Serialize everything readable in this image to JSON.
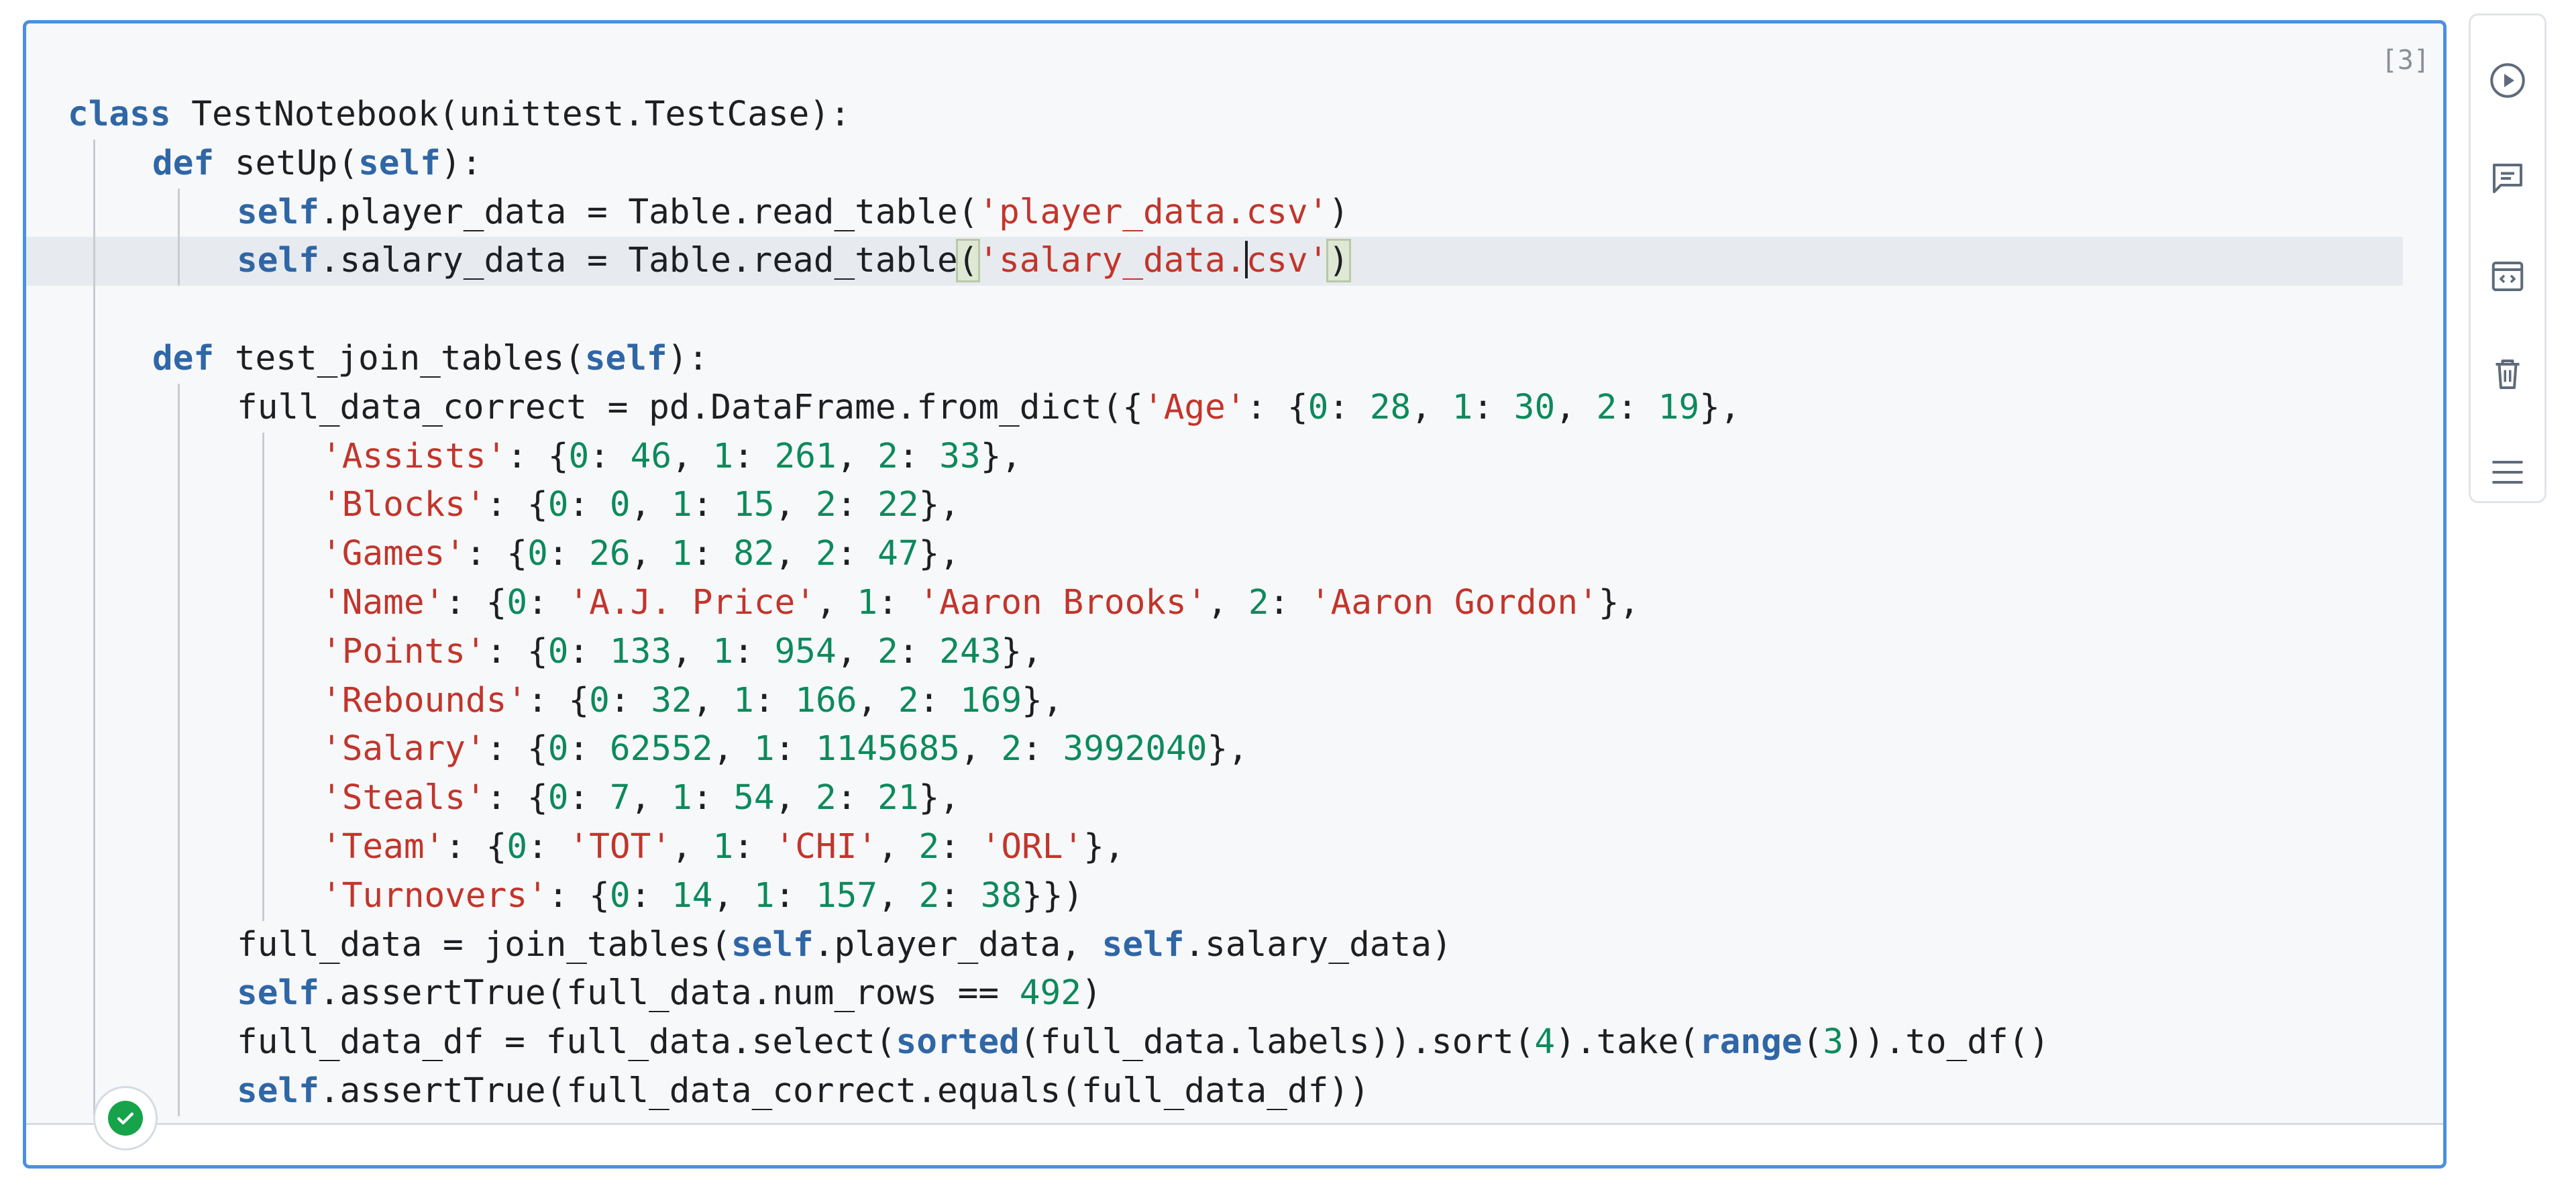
{
  "cell": {
    "execution_count": "[3]",
    "status": "success"
  },
  "code_lines": [
    {
      "indent": 0,
      "tokens": [
        {
          "t": "kw",
          "v": "class"
        },
        {
          "t": "p",
          "v": " TestNotebook(unittest.TestCase):"
        }
      ]
    },
    {
      "indent": 1,
      "tokens": [
        {
          "t": "kw",
          "v": "def"
        },
        {
          "t": "p",
          "v": " setUp("
        },
        {
          "t": "self",
          "v": "self"
        },
        {
          "t": "p",
          "v": "):"
        }
      ]
    },
    {
      "indent": 2,
      "tokens": [
        {
          "t": "self",
          "v": "self"
        },
        {
          "t": "p",
          "v": ".player_data = Table.read_table("
        },
        {
          "t": "str",
          "v": "'player_data.csv'"
        },
        {
          "t": "p",
          "v": ")"
        }
      ]
    },
    {
      "indent": 2,
      "active": true,
      "tokens": [
        {
          "t": "self",
          "v": "self"
        },
        {
          "t": "p",
          "v": ".salary_data = Table.read_table"
        },
        {
          "t": "bh",
          "v": "("
        },
        {
          "t": "str",
          "v": "'salary_data."
        },
        {
          "t": "cursor",
          "v": ""
        },
        {
          "t": "str",
          "v": "csv'"
        },
        {
          "t": "bh",
          "v": ")"
        }
      ]
    },
    {
      "indent": 0,
      "tokens": []
    },
    {
      "indent": 1,
      "tokens": [
        {
          "t": "kw",
          "v": "def"
        },
        {
          "t": "p",
          "v": " test_join_tables("
        },
        {
          "t": "self",
          "v": "self"
        },
        {
          "t": "p",
          "v": "):"
        }
      ]
    },
    {
      "indent": 2,
      "tokens": [
        {
          "t": "p",
          "v": "full_data_correct = pd.DataFrame.from_dict({"
        },
        {
          "t": "str",
          "v": "'Age'"
        },
        {
          "t": "p",
          "v": ": {"
        },
        {
          "t": "num",
          "v": "0"
        },
        {
          "t": "p",
          "v": ": "
        },
        {
          "t": "num",
          "v": "28"
        },
        {
          "t": "p",
          "v": ", "
        },
        {
          "t": "num",
          "v": "1"
        },
        {
          "t": "p",
          "v": ": "
        },
        {
          "t": "num",
          "v": "30"
        },
        {
          "t": "p",
          "v": ", "
        },
        {
          "t": "num",
          "v": "2"
        },
        {
          "t": "p",
          "v": ": "
        },
        {
          "t": "num",
          "v": "19"
        },
        {
          "t": "p",
          "v": "},"
        }
      ]
    },
    {
      "indent": 3,
      "tokens": [
        {
          "t": "str",
          "v": "'Assists'"
        },
        {
          "t": "p",
          "v": ": {"
        },
        {
          "t": "num",
          "v": "0"
        },
        {
          "t": "p",
          "v": ": "
        },
        {
          "t": "num",
          "v": "46"
        },
        {
          "t": "p",
          "v": ", "
        },
        {
          "t": "num",
          "v": "1"
        },
        {
          "t": "p",
          "v": ": "
        },
        {
          "t": "num",
          "v": "261"
        },
        {
          "t": "p",
          "v": ", "
        },
        {
          "t": "num",
          "v": "2"
        },
        {
          "t": "p",
          "v": ": "
        },
        {
          "t": "num",
          "v": "33"
        },
        {
          "t": "p",
          "v": "},"
        }
      ]
    },
    {
      "indent": 3,
      "tokens": [
        {
          "t": "str",
          "v": "'Blocks'"
        },
        {
          "t": "p",
          "v": ": {"
        },
        {
          "t": "num",
          "v": "0"
        },
        {
          "t": "p",
          "v": ": "
        },
        {
          "t": "num",
          "v": "0"
        },
        {
          "t": "p",
          "v": ", "
        },
        {
          "t": "num",
          "v": "1"
        },
        {
          "t": "p",
          "v": ": "
        },
        {
          "t": "num",
          "v": "15"
        },
        {
          "t": "p",
          "v": ", "
        },
        {
          "t": "num",
          "v": "2"
        },
        {
          "t": "p",
          "v": ": "
        },
        {
          "t": "num",
          "v": "22"
        },
        {
          "t": "p",
          "v": "},"
        }
      ]
    },
    {
      "indent": 3,
      "tokens": [
        {
          "t": "str",
          "v": "'Games'"
        },
        {
          "t": "p",
          "v": ": {"
        },
        {
          "t": "num",
          "v": "0"
        },
        {
          "t": "p",
          "v": ": "
        },
        {
          "t": "num",
          "v": "26"
        },
        {
          "t": "p",
          "v": ", "
        },
        {
          "t": "num",
          "v": "1"
        },
        {
          "t": "p",
          "v": ": "
        },
        {
          "t": "num",
          "v": "82"
        },
        {
          "t": "p",
          "v": ", "
        },
        {
          "t": "num",
          "v": "2"
        },
        {
          "t": "p",
          "v": ": "
        },
        {
          "t": "num",
          "v": "47"
        },
        {
          "t": "p",
          "v": "},"
        }
      ]
    },
    {
      "indent": 3,
      "tokens": [
        {
          "t": "str",
          "v": "'Name'"
        },
        {
          "t": "p",
          "v": ": {"
        },
        {
          "t": "num",
          "v": "0"
        },
        {
          "t": "p",
          "v": ": "
        },
        {
          "t": "str",
          "v": "'A.J. Price'"
        },
        {
          "t": "p",
          "v": ", "
        },
        {
          "t": "num",
          "v": "1"
        },
        {
          "t": "p",
          "v": ": "
        },
        {
          "t": "str",
          "v": "'Aaron Brooks'"
        },
        {
          "t": "p",
          "v": ", "
        },
        {
          "t": "num",
          "v": "2"
        },
        {
          "t": "p",
          "v": ": "
        },
        {
          "t": "str",
          "v": "'Aaron Gordon'"
        },
        {
          "t": "p",
          "v": "},"
        }
      ]
    },
    {
      "indent": 3,
      "tokens": [
        {
          "t": "str",
          "v": "'Points'"
        },
        {
          "t": "p",
          "v": ": {"
        },
        {
          "t": "num",
          "v": "0"
        },
        {
          "t": "p",
          "v": ": "
        },
        {
          "t": "num",
          "v": "133"
        },
        {
          "t": "p",
          "v": ", "
        },
        {
          "t": "num",
          "v": "1"
        },
        {
          "t": "p",
          "v": ": "
        },
        {
          "t": "num",
          "v": "954"
        },
        {
          "t": "p",
          "v": ", "
        },
        {
          "t": "num",
          "v": "2"
        },
        {
          "t": "p",
          "v": ": "
        },
        {
          "t": "num",
          "v": "243"
        },
        {
          "t": "p",
          "v": "},"
        }
      ]
    },
    {
      "indent": 3,
      "tokens": [
        {
          "t": "str",
          "v": "'Rebounds'"
        },
        {
          "t": "p",
          "v": ": {"
        },
        {
          "t": "num",
          "v": "0"
        },
        {
          "t": "p",
          "v": ": "
        },
        {
          "t": "num",
          "v": "32"
        },
        {
          "t": "p",
          "v": ", "
        },
        {
          "t": "num",
          "v": "1"
        },
        {
          "t": "p",
          "v": ": "
        },
        {
          "t": "num",
          "v": "166"
        },
        {
          "t": "p",
          "v": ", "
        },
        {
          "t": "num",
          "v": "2"
        },
        {
          "t": "p",
          "v": ": "
        },
        {
          "t": "num",
          "v": "169"
        },
        {
          "t": "p",
          "v": "},"
        }
      ]
    },
    {
      "indent": 3,
      "tokens": [
        {
          "t": "str",
          "v": "'Salary'"
        },
        {
          "t": "p",
          "v": ": {"
        },
        {
          "t": "num",
          "v": "0"
        },
        {
          "t": "p",
          "v": ": "
        },
        {
          "t": "num",
          "v": "62552"
        },
        {
          "t": "p",
          "v": ", "
        },
        {
          "t": "num",
          "v": "1"
        },
        {
          "t": "p",
          "v": ": "
        },
        {
          "t": "num",
          "v": "1145685"
        },
        {
          "t": "p",
          "v": ", "
        },
        {
          "t": "num",
          "v": "2"
        },
        {
          "t": "p",
          "v": ": "
        },
        {
          "t": "num",
          "v": "3992040"
        },
        {
          "t": "p",
          "v": "},"
        }
      ]
    },
    {
      "indent": 3,
      "tokens": [
        {
          "t": "str",
          "v": "'Steals'"
        },
        {
          "t": "p",
          "v": ": {"
        },
        {
          "t": "num",
          "v": "0"
        },
        {
          "t": "p",
          "v": ": "
        },
        {
          "t": "num",
          "v": "7"
        },
        {
          "t": "p",
          "v": ", "
        },
        {
          "t": "num",
          "v": "1"
        },
        {
          "t": "p",
          "v": ": "
        },
        {
          "t": "num",
          "v": "54"
        },
        {
          "t": "p",
          "v": ", "
        },
        {
          "t": "num",
          "v": "2"
        },
        {
          "t": "p",
          "v": ": "
        },
        {
          "t": "num",
          "v": "21"
        },
        {
          "t": "p",
          "v": "},"
        }
      ]
    },
    {
      "indent": 3,
      "tokens": [
        {
          "t": "str",
          "v": "'Team'"
        },
        {
          "t": "p",
          "v": ": {"
        },
        {
          "t": "num",
          "v": "0"
        },
        {
          "t": "p",
          "v": ": "
        },
        {
          "t": "str",
          "v": "'TOT'"
        },
        {
          "t": "p",
          "v": ", "
        },
        {
          "t": "num",
          "v": "1"
        },
        {
          "t": "p",
          "v": ": "
        },
        {
          "t": "str",
          "v": "'CHI'"
        },
        {
          "t": "p",
          "v": ", "
        },
        {
          "t": "num",
          "v": "2"
        },
        {
          "t": "p",
          "v": ": "
        },
        {
          "t": "str",
          "v": "'ORL'"
        },
        {
          "t": "p",
          "v": "},"
        }
      ]
    },
    {
      "indent": 3,
      "tokens": [
        {
          "t": "str",
          "v": "'Turnovers'"
        },
        {
          "t": "p",
          "v": ": {"
        },
        {
          "t": "num",
          "v": "0"
        },
        {
          "t": "p",
          "v": ": "
        },
        {
          "t": "num",
          "v": "14"
        },
        {
          "t": "p",
          "v": ", "
        },
        {
          "t": "num",
          "v": "1"
        },
        {
          "t": "p",
          "v": ": "
        },
        {
          "t": "num",
          "v": "157"
        },
        {
          "t": "p",
          "v": ", "
        },
        {
          "t": "num",
          "v": "2"
        },
        {
          "t": "p",
          "v": ": "
        },
        {
          "t": "num",
          "v": "38"
        },
        {
          "t": "p",
          "v": "}})"
        }
      ]
    },
    {
      "indent": 2,
      "tokens": [
        {
          "t": "p",
          "v": "full_data = join_tables("
        },
        {
          "t": "self",
          "v": "self"
        },
        {
          "t": "p",
          "v": ".player_data, "
        },
        {
          "t": "self",
          "v": "self"
        },
        {
          "t": "p",
          "v": ".salary_data)"
        }
      ]
    },
    {
      "indent": 2,
      "tokens": [
        {
          "t": "self",
          "v": "self"
        },
        {
          "t": "p",
          "v": ".assertTrue(full_data.num_rows == "
        },
        {
          "t": "num",
          "v": "492"
        },
        {
          "t": "p",
          "v": ")"
        }
      ]
    },
    {
      "indent": 2,
      "tokens": [
        {
          "t": "p",
          "v": "full_data_df = full_data.select("
        },
        {
          "t": "builtin",
          "v": "sorted"
        },
        {
          "t": "p",
          "v": "(full_data.labels)).sort("
        },
        {
          "t": "num",
          "v": "4"
        },
        {
          "t": "p",
          "v": ").take("
        },
        {
          "t": "builtin",
          "v": "range"
        },
        {
          "t": "p",
          "v": "("
        },
        {
          "t": "num",
          "v": "3"
        },
        {
          "t": "p",
          "v": ")).to_df()"
        }
      ]
    },
    {
      "indent": 2,
      "tokens": [
        {
          "t": "self",
          "v": "self"
        },
        {
          "t": "p",
          "v": ".assertTrue(full_data_correct.equals(full_data_df))"
        }
      ]
    }
  ],
  "toolbar": {
    "buttons": [
      {
        "name": "run-cell-button",
        "icon": "play-circle-icon"
      },
      {
        "name": "comment-button",
        "icon": "comment-icon"
      },
      {
        "name": "code-view-button",
        "icon": "code-icon"
      },
      {
        "name": "delete-cell-button",
        "icon": "trash-icon"
      },
      {
        "name": "more-menu-button",
        "icon": "menu-icon"
      }
    ]
  },
  "colors": {
    "accent": "#4a90e2",
    "keyword": "#2f66a6",
    "string": "#c2352b",
    "number": "#0d8a5b",
    "success": "#17a34a"
  }
}
